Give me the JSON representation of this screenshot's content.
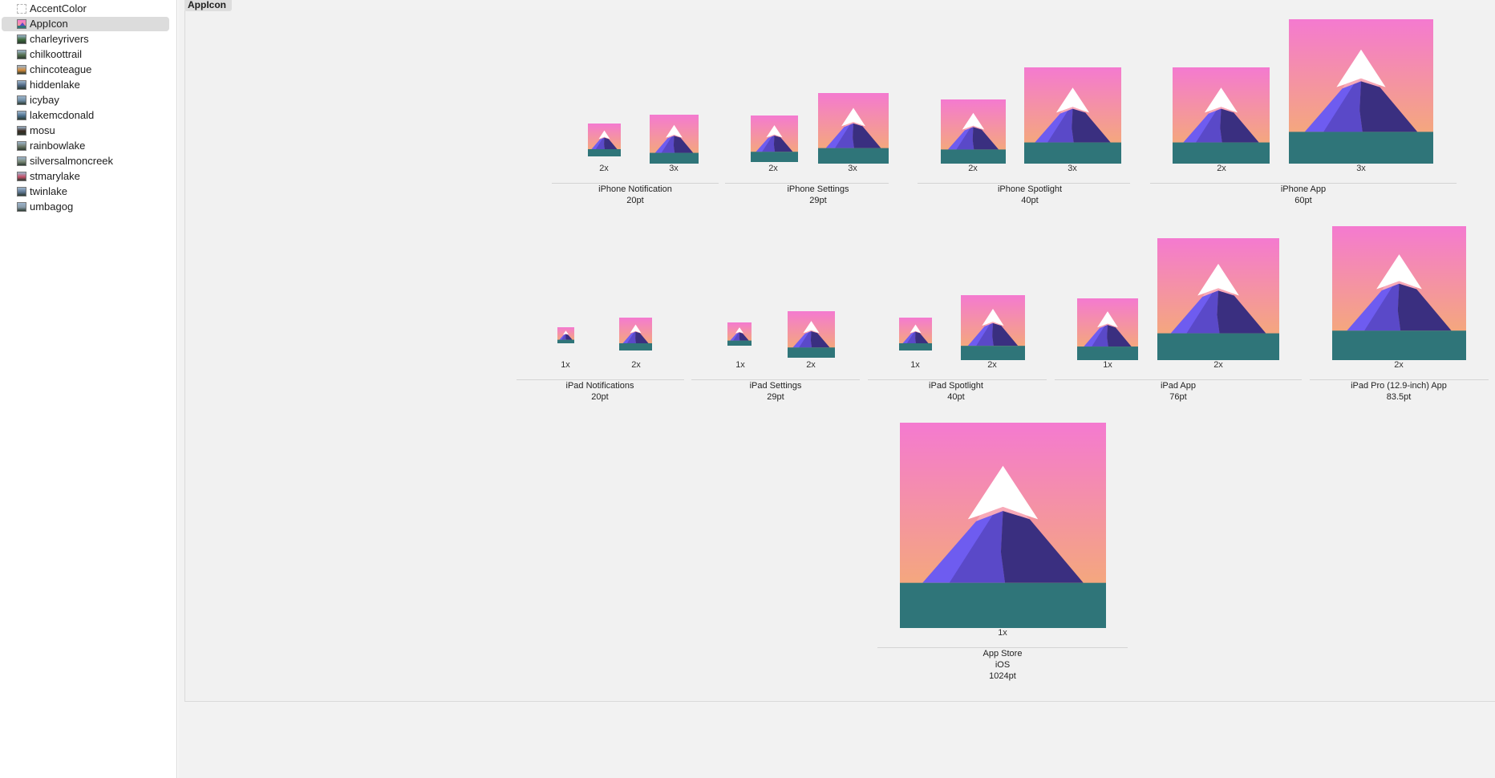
{
  "sidebar": {
    "items": [
      {
        "label": "AccentColor",
        "thumb": "dashed"
      },
      {
        "label": "AppIcon",
        "thumb": "appicon",
        "selected": true
      },
      {
        "label": "charleyrivers",
        "thumb": "#3c6a3a"
      },
      {
        "label": "chilkoottrail",
        "thumb": "#55704f"
      },
      {
        "label": "chincoteague",
        "thumb": "#d58b3a"
      },
      {
        "label": "hiddenlake",
        "thumb": "#4d6683"
      },
      {
        "label": "icybay",
        "thumb": "#6c8aa1"
      },
      {
        "label": "lakemcdonald",
        "thumb": "#4a6e8c"
      },
      {
        "label": "mosu",
        "thumb": "#3a2a20"
      },
      {
        "label": "rainbowlake",
        "thumb": "#6f7a6a"
      },
      {
        "label": "silversalmoncreek",
        "thumb": "#7b8a77"
      },
      {
        "label": "stmarylake",
        "thumb": "#c8506a"
      },
      {
        "label": "twinlake",
        "thumb": "#5e7692"
      },
      {
        "label": "umbagog",
        "thumb": "#8799a7"
      }
    ]
  },
  "set_title": "AppIcon",
  "groups": [
    {
      "name": "iPhone Notification",
      "size": "20pt",
      "scales": [
        "2x",
        "3x"
      ]
    },
    {
      "name": "iPhone Settings",
      "size": "29pt",
      "scales": [
        "2x",
        "3x"
      ]
    },
    {
      "name": "iPhone Spotlight",
      "size": "40pt",
      "scales": [
        "2x",
        "3x"
      ]
    },
    {
      "name": "iPhone App",
      "size": "60pt",
      "scales": [
        "2x",
        "3x"
      ]
    },
    {
      "name": "iPad Notifications",
      "size": "20pt",
      "scales": [
        "1x",
        "2x"
      ]
    },
    {
      "name": "iPad Settings",
      "size": "29pt",
      "scales": [
        "1x",
        "2x"
      ]
    },
    {
      "name": "iPad Spotlight",
      "size": "40pt",
      "scales": [
        "1x",
        "2x"
      ]
    },
    {
      "name": "iPad App",
      "size": "76pt",
      "scales": [
        "1x",
        "2x"
      ]
    },
    {
      "name": "iPad Pro (12.9-inch) App",
      "size": "83.5pt",
      "scales": [
        "2x"
      ]
    },
    {
      "name": "App Store",
      "platform": "iOS",
      "size": "1024pt",
      "scales": [
        "1x"
      ]
    }
  ],
  "colors": {
    "sky_top": "#f47ad0",
    "sky_bottom": "#f4a87c",
    "snow": "#ffffff",
    "ridge": "#f7a9b8",
    "mountain_light": "#6e5cf0",
    "mountain_mid": "#5a49c8",
    "mountain_dark": "#3a2f80",
    "ground": "#2f7579"
  }
}
